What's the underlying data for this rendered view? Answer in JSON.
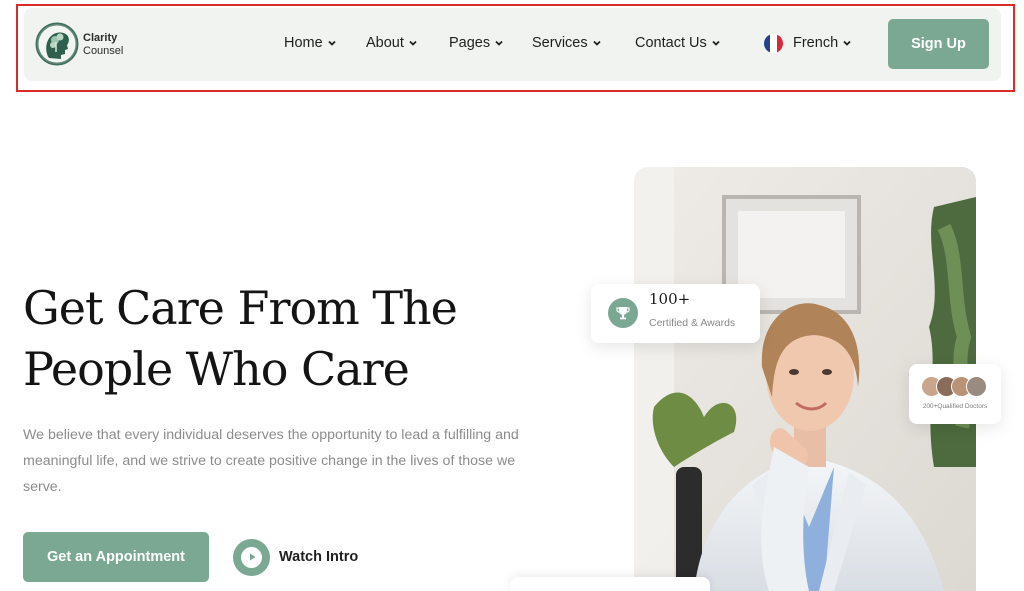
{
  "brand": {
    "line1": "Clarity",
    "line2": "Counsel",
    "accent_color": "#7aa892",
    "icon": "tree-head-logo-icon"
  },
  "nav": {
    "items": [
      {
        "label": "Home"
      },
      {
        "label": "About"
      },
      {
        "label": "Pages"
      },
      {
        "label": "Services"
      },
      {
        "label": "Contact Us"
      }
    ],
    "language": {
      "label": "French",
      "icon": "french-flag-icon"
    },
    "signup_label": "Sign Up"
  },
  "hero": {
    "title_line1": "Get Care From The",
    "title_line2": "People Who Care",
    "subtitle": "We believe that every individual deserves the opportunity to lead a fulfilling and meaningful life, and we strive to create positive change in the lives of those we serve.",
    "cta_label": "Get an Appointment",
    "watch_label": "Watch Intro"
  },
  "stats": {
    "awards_value": "100+",
    "awards_label": "Certified & Awards",
    "awards_icon": "trophy-icon",
    "doctors_label": "200+Qualified Doctors"
  },
  "highlight_color": "#d92b2b"
}
